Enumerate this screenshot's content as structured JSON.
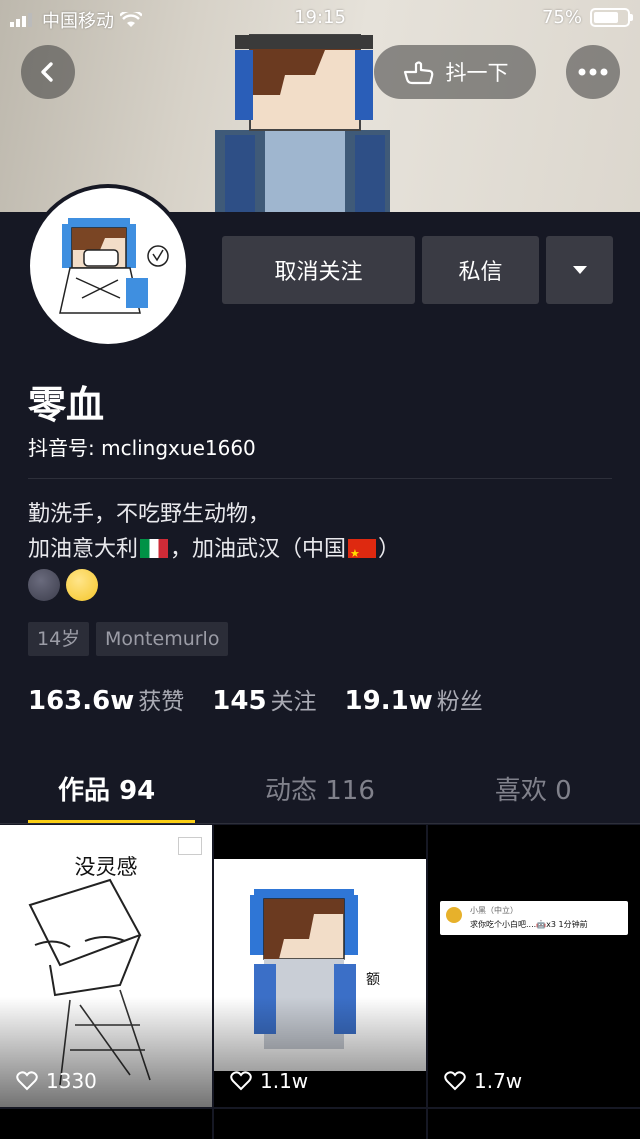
{
  "status_bar": {
    "carrier": "中国移动",
    "time": "19:15",
    "battery_text": "75%",
    "battery_level": 0.75
  },
  "header": {
    "shake_label": "抖一下"
  },
  "profile": {
    "name": "零血",
    "douyin_id": "抖音号: mclingxue1660",
    "bio_line1": "勤洗手，不吃野生动物，",
    "bio_line2_a": "加油意大利",
    "bio_line2_b": "，加油武汉（中国",
    "bio_line2_c": "）",
    "tags": {
      "age": "14岁",
      "location": "Montemurlo"
    }
  },
  "actions": {
    "unfollow_label": "取消关注",
    "message_label": "私信"
  },
  "stats": [
    {
      "value": "163.6w",
      "label": "获赞"
    },
    {
      "value": "145",
      "label": "关注"
    },
    {
      "value": "19.1w",
      "label": "粉丝"
    }
  ],
  "tabs": [
    {
      "label": "作品 94",
      "active": true
    },
    {
      "label": "动态 116",
      "active": false
    },
    {
      "label": "喜欢 0",
      "active": false
    }
  ],
  "videos": [
    {
      "caption": "没灵感",
      "likes": "1330"
    },
    {
      "caption": "额",
      "likes": "1.1w"
    },
    {
      "comment_user": "小黑（中立）",
      "comment_text": "求你吃个小白吧....🤖x3 1分钟前",
      "likes": "1.7w"
    }
  ],
  "colors": {
    "background": "#161824",
    "button": "#3a3b44",
    "tab_indicator": "#face15"
  }
}
